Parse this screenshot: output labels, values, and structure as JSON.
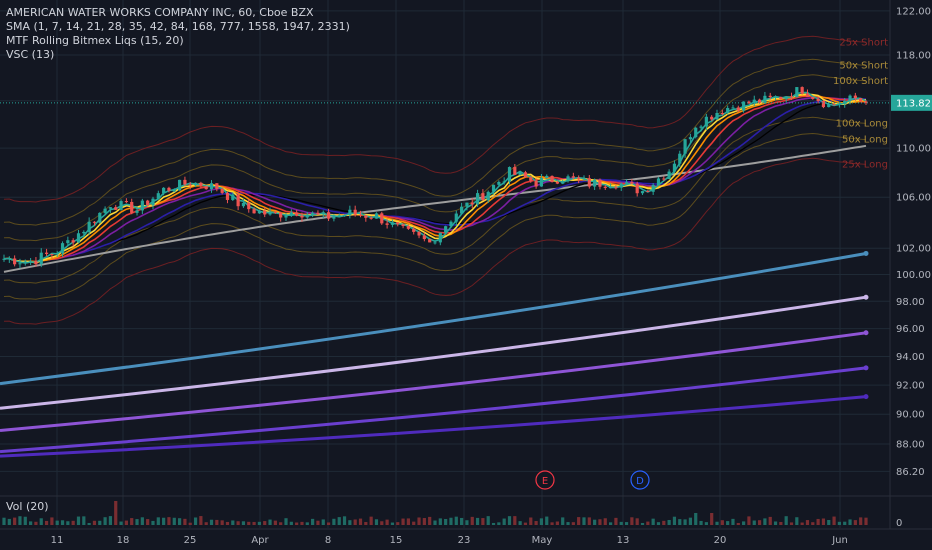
{
  "header": {
    "title": "AMERICAN WATER WORKS COMPANY INC, 60, Cboe BZX",
    "indicators": [
      "SMA (1, 7, 14, 21, 28, 35, 42, 84, 168, 777, 1558, 1947, 2331)",
      "MTF Rolling Bitmex Liqs (15, 20)",
      "VSC (13)"
    ]
  },
  "volume_pane": {
    "label": "Vol (20)",
    "axis_label": "0"
  },
  "markers": [
    {
      "letter": "E",
      "color": "#f23645"
    },
    {
      "letter": "D",
      "color": "#2962ff"
    }
  ],
  "band_labels": [
    {
      "text": "25x Short",
      "color": "#8e2a2a"
    },
    {
      "text": "50x Short",
      "color": "#a88a3a"
    },
    {
      "text": "100x Short",
      "color": "#a88a3a"
    },
    {
      "text": "100x Long",
      "color": "#a88a3a"
    },
    {
      "text": "50x Long",
      "color": "#a88a3a"
    },
    {
      "text": "25x Long",
      "color": "#8e2a2a"
    }
  ],
  "price_tag": {
    "value": "113.82",
    "color": "#26a69a"
  },
  "chart_data": {
    "type": "line",
    "title": "AMERICAN WATER WORKS COMPANY INC, 60, Cboe BZX",
    "x_ticks": [
      "11",
      "18",
      "25",
      "Apr",
      "8",
      "15",
      "23",
      "May",
      "13",
      "20",
      "Jun"
    ],
    "y_ticks": [
      "122.00",
      "118.00",
      "114.00",
      "110.00",
      "106.00",
      "102.00",
      "100.00",
      "98.00",
      "96.00",
      "94.00",
      "92.00",
      "90.00",
      "88.00",
      "86.20"
    ],
    "ylim": [
      85,
      123
    ],
    "y_scale": "log",
    "last_price": 113.82,
    "price_series": {
      "name": "Close",
      "points": [
        [
          0,
          101.2
        ],
        [
          5,
          101.0
        ],
        [
          10,
          101.8
        ],
        [
          15,
          103.5
        ],
        [
          20,
          105.5
        ],
        [
          25,
          105.0
        ],
        [
          30,
          106.6
        ],
        [
          35,
          107.2
        ],
        [
          40,
          106.8
        ],
        [
          45,
          105.2
        ],
        [
          50,
          104.6
        ],
        [
          55,
          104.9
        ],
        [
          60,
          104.4
        ],
        [
          65,
          104.7
        ],
        [
          70,
          104.5
        ],
        [
          75,
          103.3
        ],
        [
          80,
          102.4
        ],
        [
          85,
          104.8
        ],
        [
          90,
          106.2
        ],
        [
          95,
          108.0
        ],
        [
          100,
          107.2
        ],
        [
          105,
          107.6
        ],
        [
          110,
          107.1
        ],
        [
          115,
          107.2
        ],
        [
          120,
          106.5
        ],
        [
          125,
          108.2
        ],
        [
          130,
          112.0
        ],
        [
          135,
          113.3
        ],
        [
          140,
          113.8
        ],
        [
          145,
          114.2
        ],
        [
          150,
          115.0
        ],
        [
          155,
          113.6
        ],
        [
          160,
          114.2
        ],
        [
          162,
          113.82
        ]
      ]
    },
    "series": [
      {
        "name": "SMA 1558",
        "color": "#4a8fbd",
        "from": 92.1,
        "to": 101.6
      },
      {
        "name": "SMA 1947",
        "color": "#cbb6e8",
        "from": 90.4,
        "to": 98.3
      },
      {
        "name": "SMA 2331",
        "color": "#8f55d6",
        "from": 88.9,
        "to": 95.7
      },
      {
        "name": "SMA 777-b",
        "color": "#6a3fcf",
        "from": 87.5,
        "to": 93.2
      },
      {
        "name": "SMA 777-c",
        "color": "#4f2bbd",
        "from": 87.2,
        "to": 91.2
      }
    ],
    "grid": true,
    "legend": "top-left"
  }
}
